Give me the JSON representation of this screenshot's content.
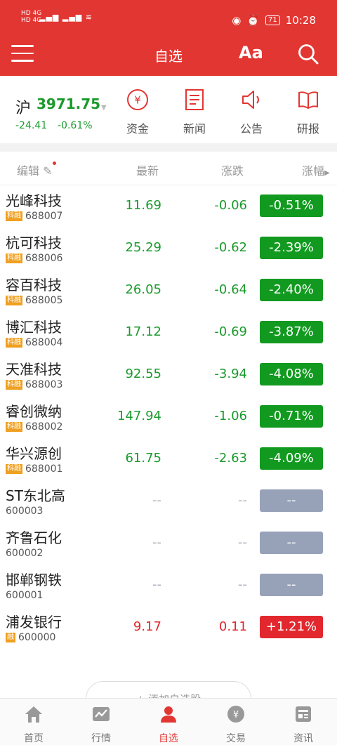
{
  "status": {
    "net1": "HD 4G",
    "net2": "HD 4G",
    "battery": "71",
    "time": "10:28"
  },
  "appbar": {
    "title": "自选",
    "font_label": "Aa"
  },
  "index": {
    "name": "沪",
    "value": "3971.75",
    "change": "-24.41",
    "pct": "-0.61%"
  },
  "quick_links": [
    {
      "label": "资金",
      "icon": "yuan-circle-icon"
    },
    {
      "label": "新闻",
      "icon": "document-icon"
    },
    {
      "label": "公告",
      "icon": "speaker-icon"
    },
    {
      "label": "研报",
      "icon": "book-icon"
    }
  ],
  "table": {
    "headers": {
      "edit": "编辑",
      "latest": "最新",
      "change": "涨跌",
      "pct": "涨幅"
    },
    "rows": [
      {
        "name": "光峰科技",
        "badge": "科融",
        "code": "688007",
        "price": "11.69",
        "change": "-0.06",
        "pct": "-0.51%",
        "color": "#1a9a2c"
      },
      {
        "name": "杭可科技",
        "badge": "科融",
        "code": "688006",
        "price": "25.29",
        "change": "-0.62",
        "pct": "-2.39%",
        "color": "#1a9a2c"
      },
      {
        "name": "容百科技",
        "badge": "科融",
        "code": "688005",
        "price": "26.05",
        "change": "-0.64",
        "pct": "-2.40%",
        "color": "#1a9a2c"
      },
      {
        "name": "博汇科技",
        "badge": "科融",
        "code": "688004",
        "price": "17.12",
        "change": "-0.69",
        "pct": "-3.87%",
        "color": "#1a9a2c"
      },
      {
        "name": "天准科技",
        "badge": "科融",
        "code": "688003",
        "price": "92.55",
        "change": "-3.94",
        "pct": "-4.08%",
        "color": "#1a9a2c"
      },
      {
        "name": "睿创微纳",
        "badge": "科融",
        "code": "688002",
        "price": "147.94",
        "change": "-1.06",
        "pct": "-0.71%",
        "color": "#1a9a2c"
      },
      {
        "name": "华兴源创",
        "badge": "科融",
        "code": "688001",
        "price": "61.75",
        "change": "-2.63",
        "pct": "-4.09%",
        "color": "#1a9a2c"
      },
      {
        "name": "ST东北高",
        "badge": "",
        "code": "600003",
        "price": "--",
        "change": "--",
        "pct": "--",
        "color": "#97a2b8"
      },
      {
        "name": "齐鲁石化",
        "badge": "",
        "code": "600002",
        "price": "--",
        "change": "--",
        "pct": "--",
        "color": "#97a2b8"
      },
      {
        "name": "邯郸钢铁",
        "badge": "",
        "code": "600001",
        "price": "--",
        "change": "--",
        "pct": "--",
        "color": "#97a2b8"
      },
      {
        "name": "浦发银行",
        "badge": "融",
        "code": "600000",
        "price": "9.17",
        "change": "0.11",
        "pct": "+1.21%",
        "color": "#e0242c"
      }
    ]
  },
  "add_button": "+ 添加自选股",
  "tabs": [
    {
      "label": "首页",
      "icon": "home-icon"
    },
    {
      "label": "行情",
      "icon": "chart-icon"
    },
    {
      "label": "自选",
      "icon": "person-icon"
    },
    {
      "label": "交易",
      "icon": "yuan-coin-icon"
    },
    {
      "label": "资讯",
      "icon": "news-icon"
    }
  ],
  "colors": {
    "brand": "#e23632",
    "up": "#e0242c",
    "down": "#1a9a2c",
    "flat": "#97a2b8"
  }
}
